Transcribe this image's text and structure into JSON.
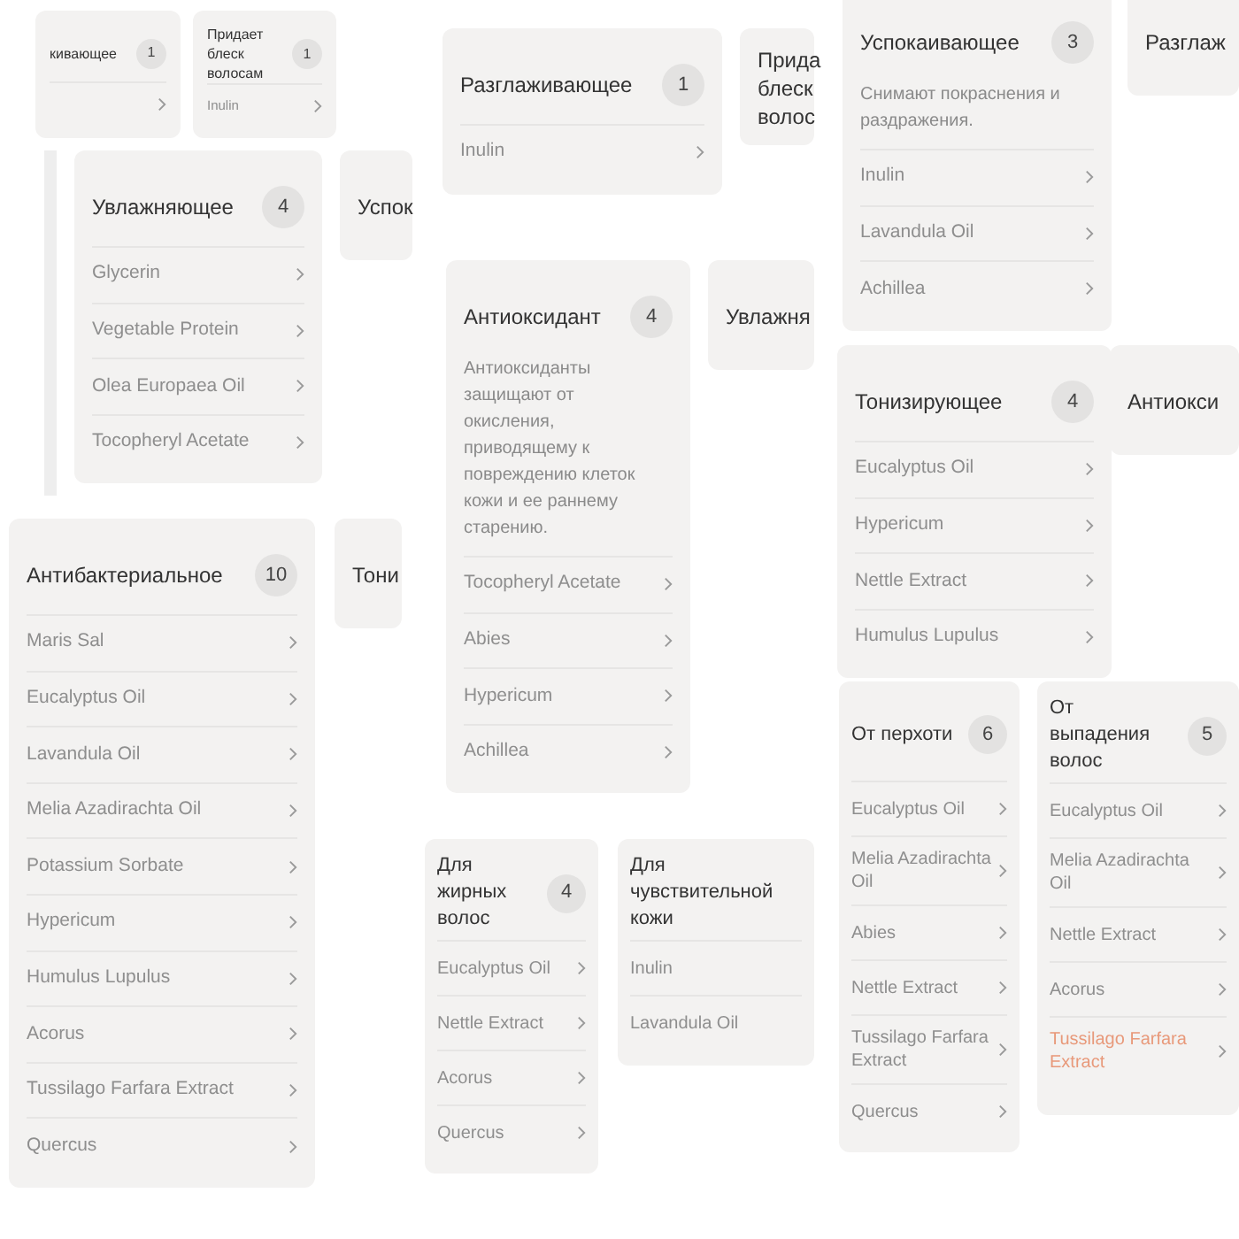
{
  "cards": [
    {
      "title": "кивающее",
      "badge": "1",
      "cut_row": true
    },
    {
      "title": "Придает блеск волосам",
      "badge": "1",
      "items": [
        {
          "label": "Inulin"
        }
      ]
    },
    {
      "title": "Разглаживающее",
      "badge": "1",
      "items": [
        {
          "label": "Inulin"
        }
      ]
    },
    {
      "title": "Прида блеск волос"
    },
    {
      "title": "Успокаивающее",
      "badge": "3",
      "description": "Снимают покраснения и раздражения.",
      "items": [
        {
          "label": "Inulin"
        },
        {
          "label": "Lavandula Oil"
        },
        {
          "label": "Achillea"
        }
      ]
    },
    {
      "title": "Разглаж"
    },
    {
      "title": "Увлажняющее",
      "badge": "4",
      "items": [
        {
          "label": "Glycerin"
        },
        {
          "label": "Vegetable Protein"
        },
        {
          "label": "Olea Europaea Oil"
        },
        {
          "label": "Tocopheryl Acetate"
        }
      ]
    },
    {
      "title": "Успок"
    },
    {
      "title": "Антибактериальное",
      "badge": "10",
      "items": [
        {
          "label": "Maris Sal"
        },
        {
          "label": "Eucalyptus Oil"
        },
        {
          "label": "Lavandula Oil"
        },
        {
          "label": "Melia Azadirachta Oil"
        },
        {
          "label": "Potassium Sorbate"
        },
        {
          "label": "Hypericum"
        },
        {
          "label": "Humulus Lupulus"
        },
        {
          "label": "Acorus"
        },
        {
          "label": "Tussilago Farfara Extract"
        },
        {
          "label": "Quercus"
        }
      ]
    },
    {
      "title": "Тони"
    },
    {
      "title": "Антиоксидант",
      "badge": "4",
      "description": "Антиоксиданты защищают от окисления, приводящему к повреждению клеток кожи и ее раннему старению.",
      "items": [
        {
          "label": "Tocopheryl Acetate"
        },
        {
          "label": "Abies"
        },
        {
          "label": "Hypericum"
        },
        {
          "label": "Achillea"
        }
      ]
    },
    {
      "title": "Увлажня"
    },
    {
      "title": "Тонизирующее",
      "badge": "4",
      "items": [
        {
          "label": "Eucalyptus Oil"
        },
        {
          "label": "Hypericum"
        },
        {
          "label": "Nettle Extract"
        },
        {
          "label": "Humulus Lupulus"
        }
      ]
    },
    {
      "title": "Антиокси"
    },
    {
      "title": "Для жирных волос",
      "badge": "4",
      "items": [
        {
          "label": "Eucalyptus Oil"
        },
        {
          "label": "Nettle Extract"
        },
        {
          "label": "Acorus"
        },
        {
          "label": "Quercus"
        }
      ]
    },
    {
      "title": "Для чувствительной кожи",
      "chevron": false,
      "items": [
        {
          "label": "Inulin"
        },
        {
          "label": "Lavandula Oil"
        }
      ]
    },
    {
      "title": "От перхоти",
      "badge": "6",
      "items": [
        {
          "label": "Eucalyptus Oil"
        },
        {
          "label": "Melia Azadirachta Oil"
        },
        {
          "label": "Abies"
        },
        {
          "label": "Nettle Extract"
        },
        {
          "label": "Tussilago Farfara Extract"
        },
        {
          "label": "Quercus"
        }
      ]
    },
    {
      "title": "От выпадения волос",
      "badge": "5",
      "items": [
        {
          "label": "Eucalyptus Oil",
          "selected": false
        },
        {
          "label": "Melia Azadirachta Oil",
          "selected": false
        },
        {
          "label": "Nettle Extract",
          "selected": false
        },
        {
          "label": "Acorus",
          "selected": false
        },
        {
          "label": "Tussilago Farfara Extract",
          "selected": true
        }
      ]
    }
  ]
}
